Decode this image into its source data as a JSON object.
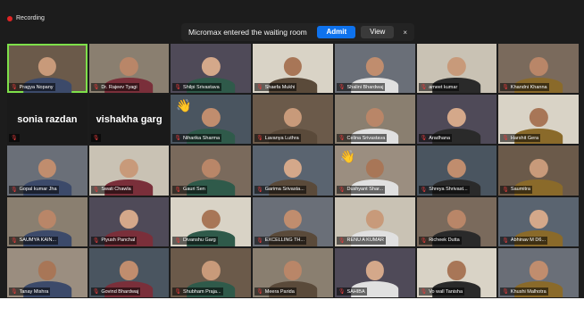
{
  "recording": {
    "label": "Recording",
    "color": "#e02424"
  },
  "notification": {
    "message": "Micromax entered the waiting room",
    "admit_label": "Admit",
    "view_label": "View",
    "close_symbol": "×"
  },
  "participants": [
    {
      "name": "Pragya Nopany",
      "active": true
    },
    {
      "name": "Dr. Rajeev Tyagi"
    },
    {
      "name": "Shilpi Srivastava"
    },
    {
      "name": "Shaefa Mukhi"
    },
    {
      "name": "Shalini Bhardwaj"
    },
    {
      "name": "ameet kumar"
    },
    {
      "name": "Khandni Khanna"
    },
    {
      "name": "sonia razdan",
      "blank": true
    },
    {
      "name": "vishakha garg",
      "blank": true
    },
    {
      "name": "Niharika Sharma",
      "hand": true
    },
    {
      "name": "Lavanya Luthra"
    },
    {
      "name": "Celina Srivastava"
    },
    {
      "name": "Aradhana"
    },
    {
      "name": "Harshit Gera"
    },
    {
      "name": "Gopal kumar Jha"
    },
    {
      "name": "Swati Chawla"
    },
    {
      "name": "Gauri Sen"
    },
    {
      "name": "Garima Srivasta..."
    },
    {
      "name": "Dushyant Shar...",
      "hand": true
    },
    {
      "name": "Shreya Shrivast..."
    },
    {
      "name": "Saumitra"
    },
    {
      "name": "SAUMYA KAIN..."
    },
    {
      "name": "Piyush Panchal"
    },
    {
      "name": "Divanshu Garg"
    },
    {
      "name": "EXCELLING TH..."
    },
    {
      "name": "RENU A KUMAR"
    },
    {
      "name": "Richeek Dutta"
    },
    {
      "name": "Abhinav M D6..."
    },
    {
      "name": "Tanay Mishra"
    },
    {
      "name": "Govind Bhardwaj"
    },
    {
      "name": "Shubham Praja..."
    },
    {
      "name": "Meera Parida"
    },
    {
      "name": "SAHIBA"
    },
    {
      "name": "Vo wall Tanisha"
    },
    {
      "name": "Khushi Malhotra"
    }
  ]
}
